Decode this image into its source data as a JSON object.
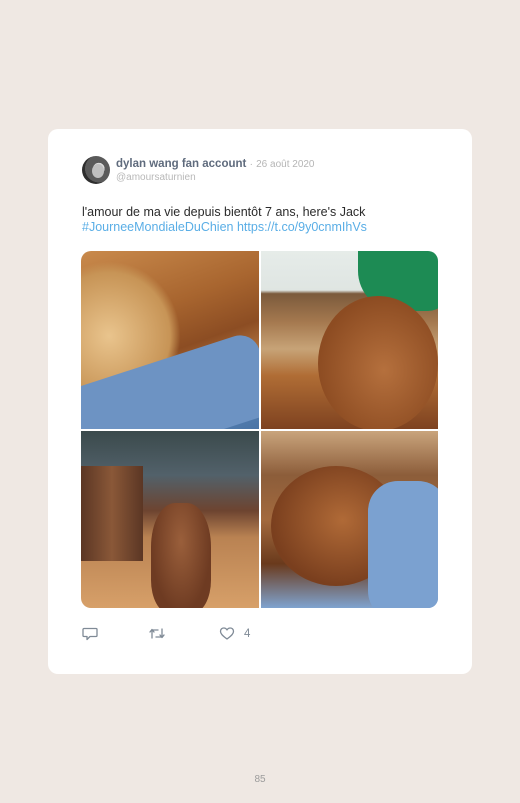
{
  "tweet": {
    "display_name": "dylan wang fan account",
    "separator": "·",
    "date": "26 août 2020",
    "handle": "@amoursaturnien",
    "text": "l'amour de ma vie depuis bientôt 7 ans, here's Jack",
    "hashtag": "#JourneeMondialeDuChien",
    "link": "https://t.co/9y0cnmIhVs",
    "photos": [
      {
        "icon": "dog-photo"
      },
      {
        "icon": "dog-photo"
      },
      {
        "icon": "dog-photo"
      },
      {
        "icon": "dog-photo"
      }
    ],
    "actions": {
      "reply_icon": "reply-icon",
      "retweet_icon": "retweet-icon",
      "like_icon": "heart-icon",
      "like_count": "4"
    }
  },
  "page": {
    "number": "85"
  },
  "colors": {
    "background": "#efe8e3",
    "card": "#ffffff",
    "link": "#5aaee6",
    "name": "#5f6b7d"
  }
}
